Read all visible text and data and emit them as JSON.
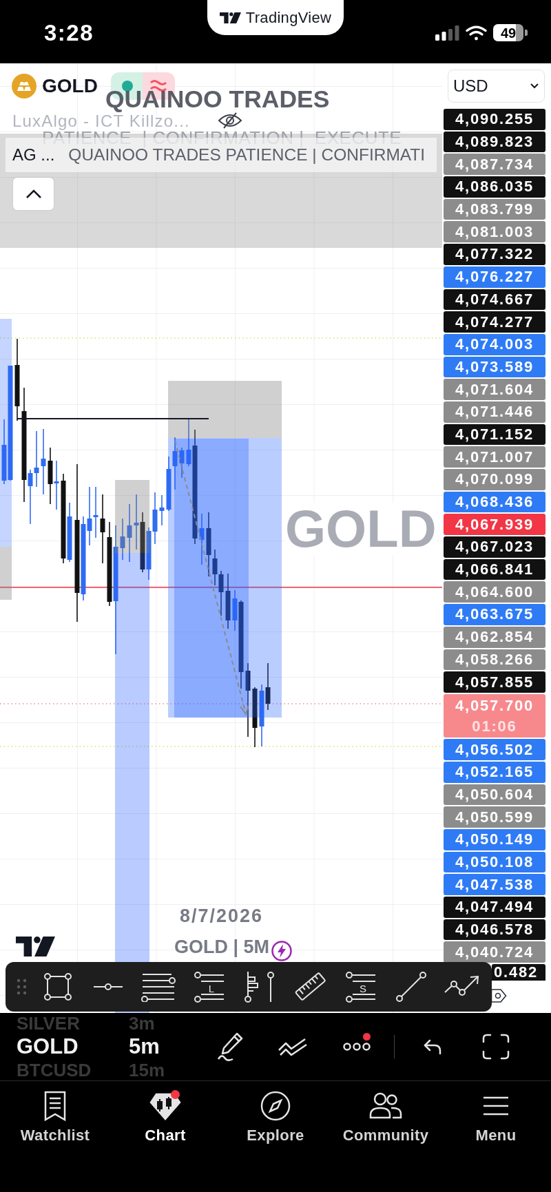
{
  "status_bar": {
    "time": "3:28",
    "app_pill": "TradingView",
    "battery": "49"
  },
  "header": {
    "symbol": "GOLD",
    "market_open": true,
    "watermark_title": "QUAINOO TRADES",
    "watermark_subtitle": "PATIENCE  | CONFIRMATION |  EXECUTE",
    "indicator": "LuxAlgo - ICT Killzo...",
    "indicator_hidden": true,
    "legend": [
      {
        "kind": "source",
        "text": "AG ..."
      },
      {
        "kind": "title",
        "text": "QUAINOO TRADES PATIENCE | CONFIRMATI"
      }
    ]
  },
  "chart": {
    "symbol_watermark": "GOLD",
    "date": "8/7/2026",
    "caption": "GOLD | 5M"
  },
  "price_scale": {
    "currency": "USD",
    "labels": [
      {
        "price": "4,090.255",
        "color": "#111111"
      },
      {
        "price": "4,089.823",
        "color": "#111111"
      },
      {
        "price": "4,087.734",
        "color": "#8c8c8c"
      },
      {
        "price": "4,086.035",
        "color": "#111111"
      },
      {
        "price": "4,083.799",
        "color": "#8c8c8c"
      },
      {
        "price": "4,081.003",
        "color": "#8c8c8c"
      },
      {
        "price": "4,077.322",
        "color": "#111111"
      },
      {
        "price": "4,076.227",
        "color": "#2f7bf5"
      },
      {
        "price": "4,074.667",
        "color": "#111111"
      },
      {
        "price": "4,074.277",
        "color": "#111111"
      },
      {
        "price": "4,074.003",
        "color": "#2f7bf5"
      },
      {
        "price": "4,073.589",
        "color": "#2f7bf5"
      },
      {
        "price": "4,071.604",
        "color": "#8c8c8c"
      },
      {
        "price": "4,071.446",
        "color": "#8c8c8c"
      },
      {
        "price": "4,071.152",
        "color": "#111111"
      },
      {
        "price": "4,071.007",
        "color": "#8c8c8c"
      },
      {
        "price": "4,070.099",
        "color": "#8c8c8c"
      },
      {
        "price": "4,068.436",
        "color": "#2f7bf5"
      },
      {
        "price": "4,067.939",
        "color": "#f23645"
      },
      {
        "price": "4,067.023",
        "color": "#111111"
      },
      {
        "price": "4,066.841",
        "color": "#111111"
      },
      {
        "price": "4,064.600",
        "color": "#8c8c8c"
      },
      {
        "price": "4,063.675",
        "color": "#2f7bf5"
      },
      {
        "price": "4,062.854",
        "color": "#8c8c8c"
      },
      {
        "price": "4,058.266",
        "color": "#8c8c8c"
      },
      {
        "price": "4,057.855",
        "color": "#111111"
      },
      {
        "price": "4,057.700",
        "countdown": "01:06",
        "color": "#f7898d"
      },
      {
        "price": "4,056.502",
        "color": "#2f7bf5"
      },
      {
        "price": "4,052.165",
        "color": "#2f7bf5"
      },
      {
        "price": "4,050.604",
        "color": "#8c8c8c"
      },
      {
        "price": "4,050.599",
        "color": "#8c8c8c"
      },
      {
        "price": "4,050.149",
        "color": "#2f7bf5"
      },
      {
        "price": "4,050.108",
        "color": "#2f7bf5"
      },
      {
        "price": "4,047.538",
        "color": "#2f7bf5"
      },
      {
        "price": "4,047.494",
        "color": "#111111"
      },
      {
        "price": "4,046.578",
        "color": "#111111"
      },
      {
        "price": "4,040.724",
        "color": "#8c8c8c"
      },
      {
        "price": "0.482",
        "color": "#111111"
      }
    ]
  },
  "drawing_toolbar": [
    {
      "kind": "grip"
    },
    {
      "kind": "rectangle"
    },
    {
      "kind": "line-dot"
    },
    {
      "kind": "stacked-lines"
    },
    {
      "kind": "lettered-lines",
      "letter": "L"
    },
    {
      "kind": "fork-pin"
    },
    {
      "kind": "ruler"
    },
    {
      "kind": "lettered-lines",
      "letter": "S"
    },
    {
      "kind": "diagonal-line"
    },
    {
      "kind": "polyline-arrow"
    }
  ],
  "symbol_wheel": [
    {
      "label": "SILVER",
      "selected": false
    },
    {
      "label": "GOLD",
      "selected": true
    },
    {
      "label": "BTCUSD",
      "selected": false
    }
  ],
  "interval_wheel": [
    {
      "label": "3m",
      "selected": false
    },
    {
      "label": "5m",
      "selected": true
    },
    {
      "label": "15m",
      "selected": false
    }
  ],
  "chart_actions": {
    "more_notification": true
  },
  "tabs": [
    {
      "kind": "watchlist",
      "label": "Watchlist",
      "selected": false,
      "notification": false
    },
    {
      "kind": "chart",
      "label": "Chart",
      "selected": true,
      "notification": true
    },
    {
      "kind": "explore",
      "label": "Explore",
      "selected": false,
      "notification": false
    },
    {
      "kind": "community",
      "label": "Community",
      "selected": false,
      "notification": false
    },
    {
      "kind": "menu",
      "label": "Menu",
      "selected": false,
      "notification": false
    }
  ]
}
